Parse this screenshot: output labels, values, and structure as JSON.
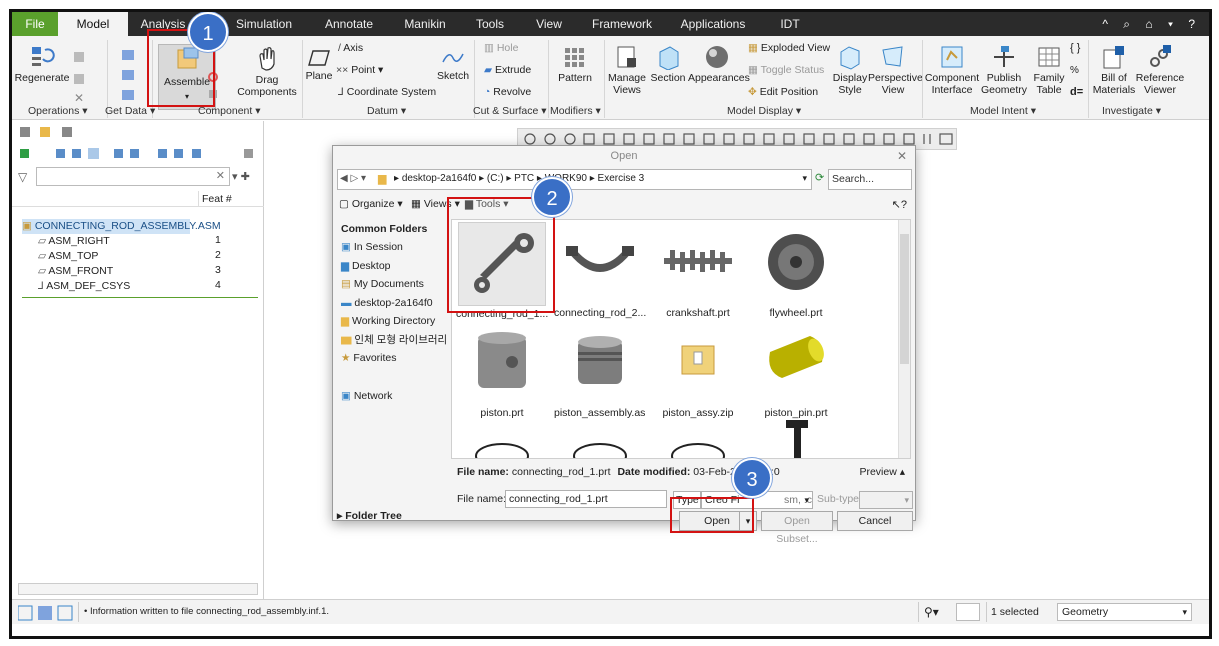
{
  "tabs": [
    {
      "label": "File"
    },
    {
      "label": "Model"
    },
    {
      "label": "Analysis"
    },
    {
      "label": "Simulation"
    },
    {
      "label": "Annotate"
    },
    {
      "label": "Manikin"
    },
    {
      "label": "Tools"
    },
    {
      "label": "View"
    },
    {
      "label": "Framework"
    },
    {
      "label": "Applications"
    },
    {
      "label": "IDT"
    }
  ],
  "tab_right_icons": "^ ⌕ ⌂ ▾ ?",
  "ribbon": {
    "regenerate": "Regenerate",
    "assemble": "Assemble",
    "drag_components_1": "Drag",
    "drag_components_2": "Components",
    "plane": "Plane",
    "axis": "Axis",
    "point": "Point",
    "coordinate_system": "Coordinate System",
    "sketch": "Sketch",
    "hole": "Hole",
    "extrude": "Extrude",
    "revolve": "Revolve",
    "pattern": "Pattern",
    "manage_views_1": "Manage",
    "manage_views_2": "Views",
    "section": "Section",
    "appearances": "Appearances",
    "exploded_view": "Exploded View",
    "toggle_status": "Toggle Status",
    "edit_position": "Edit Position",
    "display_style_1": "Display",
    "display_style_2": "Style",
    "perspective_view_1": "Perspective",
    "perspective_view_2": "View",
    "component_interface_1": "Component",
    "component_interface_2": "Interface",
    "publish_geometry_1": "Publish",
    "publish_geometry_2": "Geometry",
    "family_table_1": "Family",
    "family_table_2": "Table",
    "bill_of_materials_1": "Bill of",
    "bill_of_materials_2": "Materials",
    "reference_viewer_1": "Reference",
    "reference_viewer_2": "Viewer",
    "groups": {
      "operations": "Operations ▾",
      "get_data": "Get Data ▾",
      "component": "Component ▾",
      "datum": "Datum ▾",
      "cut_surface": "Cut & Surface ▾",
      "modifiers": "Modifiers ▾",
      "model_display": "Model Display ▾",
      "model_intent": "Model Intent ▾",
      "investigate": "Investigate ▾"
    }
  },
  "tree": {
    "feat_header": "Feat #",
    "rows": [
      {
        "label": "CONNECTING_ROD_ASSEMBLY.ASM",
        "feat": ""
      },
      {
        "label": "ASM_RIGHT",
        "feat": "1"
      },
      {
        "label": "ASM_TOP",
        "feat": "2"
      },
      {
        "label": "ASM_FRONT",
        "feat": "3"
      },
      {
        "label": "ASM_DEF_CSYS",
        "feat": "4"
      }
    ]
  },
  "status": {
    "message": "• Information written to file connecting_rod_assembly.inf.1.",
    "selected": "1 selected",
    "filter": "Geometry"
  },
  "dialog": {
    "title": "Open",
    "path": [
      "desktop-2a164f0",
      "(C:)",
      "PTC",
      "WORK90",
      "Exercise 3"
    ],
    "search_placeholder": "Search...",
    "organize": "Organize",
    "views": "Views",
    "tools": "Tools",
    "common_folders": "Common Folders",
    "folders": [
      "In Session",
      "Desktop",
      "My Documents",
      "desktop-2a164f0",
      "Working Directory",
      "인체 모형 라이브러리",
      "Favorites"
    ],
    "network": "Network",
    "folder_tree": "Folder Tree",
    "files": [
      {
        "name": "connecting_rod_1...",
        "type": "rod"
      },
      {
        "name": "connecting_rod_2...",
        "type": "cap"
      },
      {
        "name": "crankshaft.prt",
        "type": "crank"
      },
      {
        "name": "flywheel.prt",
        "type": "flywheel"
      },
      {
        "name": "piston.prt",
        "type": "piston"
      },
      {
        "name": "piston_assembly.asm",
        "type": "piston_asm"
      },
      {
        "name": "piston_assy.zip",
        "type": "zip"
      },
      {
        "name": "piston_pin.prt",
        "type": "pin"
      },
      {
        "name": "",
        "type": "ring"
      },
      {
        "name": "",
        "type": "ring"
      },
      {
        "name": "",
        "type": "ring"
      },
      {
        "name": "",
        "type": "bolt"
      }
    ],
    "info_label": "File name:",
    "info_name": "connecting_rod_1.prt",
    "info_date_label": "Date modified:",
    "info_date": "03-Feb-23 08:28:0",
    "preview": "Preview ▴",
    "filename_label": "File name:",
    "filename_value": "connecting_rod_1.prt",
    "type_label": "Type",
    "type_value": "Creo Fi",
    "type_value_tail": "sm, .c",
    "subtype_label": "Sub-type",
    "open_button": "Open",
    "open_subset_button": "Open Subset...",
    "cancel_button": "Cancel"
  },
  "callouts": [
    "1",
    "2",
    "3"
  ],
  "colors": {
    "accent": "#3a6fc6",
    "callout_red": "#d31212",
    "file_tab": "#5aa02c"
  }
}
